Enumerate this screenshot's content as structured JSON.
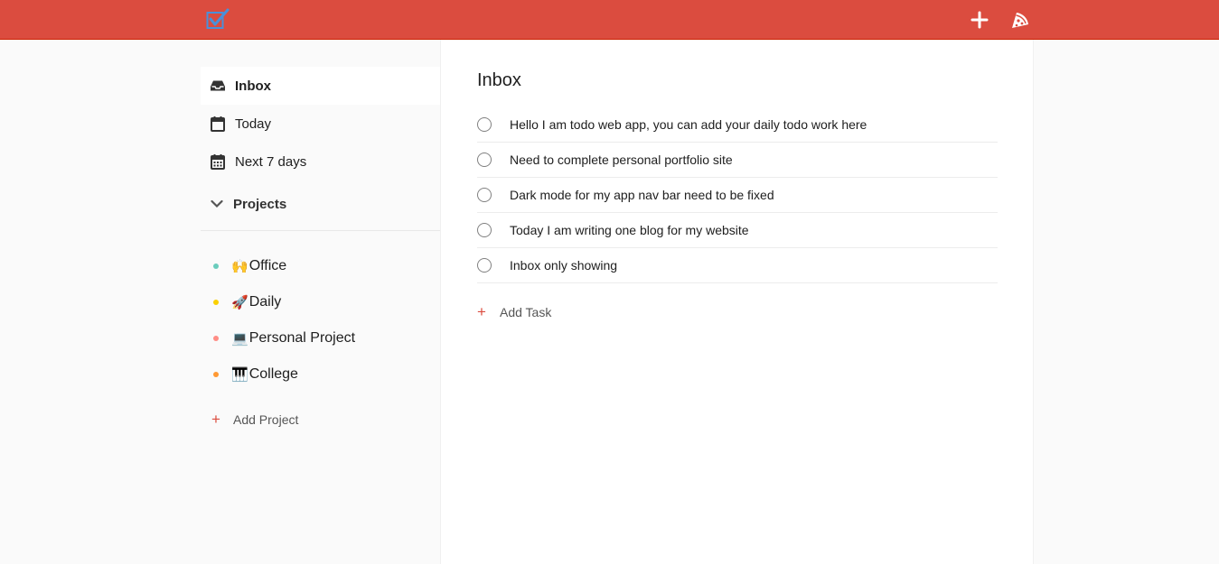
{
  "topbar": {
    "logo_icon": "checkbox-logo-icon",
    "add_icon": "plus-icon",
    "theme_icon": "pizza-icon",
    "accent_color": "#db4c3f"
  },
  "sidebar": {
    "nav": [
      {
        "label": "Inbox",
        "icon": "inbox-icon",
        "active": true
      },
      {
        "label": "Today",
        "icon": "calendar-icon",
        "active": false
      },
      {
        "label": "Next 7 days",
        "icon": "calendar-week-icon",
        "active": false
      }
    ],
    "projects_label": "Projects",
    "projects": [
      {
        "emoji": "🙌",
        "name": "Office",
        "color": "#6accbc"
      },
      {
        "emoji": "🚀",
        "name": "Daily",
        "color": "#fad000"
      },
      {
        "emoji": "💻",
        "name": "Personal Project",
        "color": "#ff8d85"
      },
      {
        "emoji": "🎹",
        "name": "College",
        "color": "#ff9933"
      }
    ],
    "add_project_plus": "+",
    "add_project_label": "Add Project"
  },
  "main": {
    "title": "Inbox",
    "tasks": [
      "Hello I am todo web app, you can add your daily todo work here",
      "Need to complete personal portfolio site",
      "Dark mode for my app nav bar need to be fixed",
      "Today I am writing one blog for my website",
      "Inbox only showing"
    ],
    "add_task_plus": "+",
    "add_task_label": "Add Task"
  }
}
